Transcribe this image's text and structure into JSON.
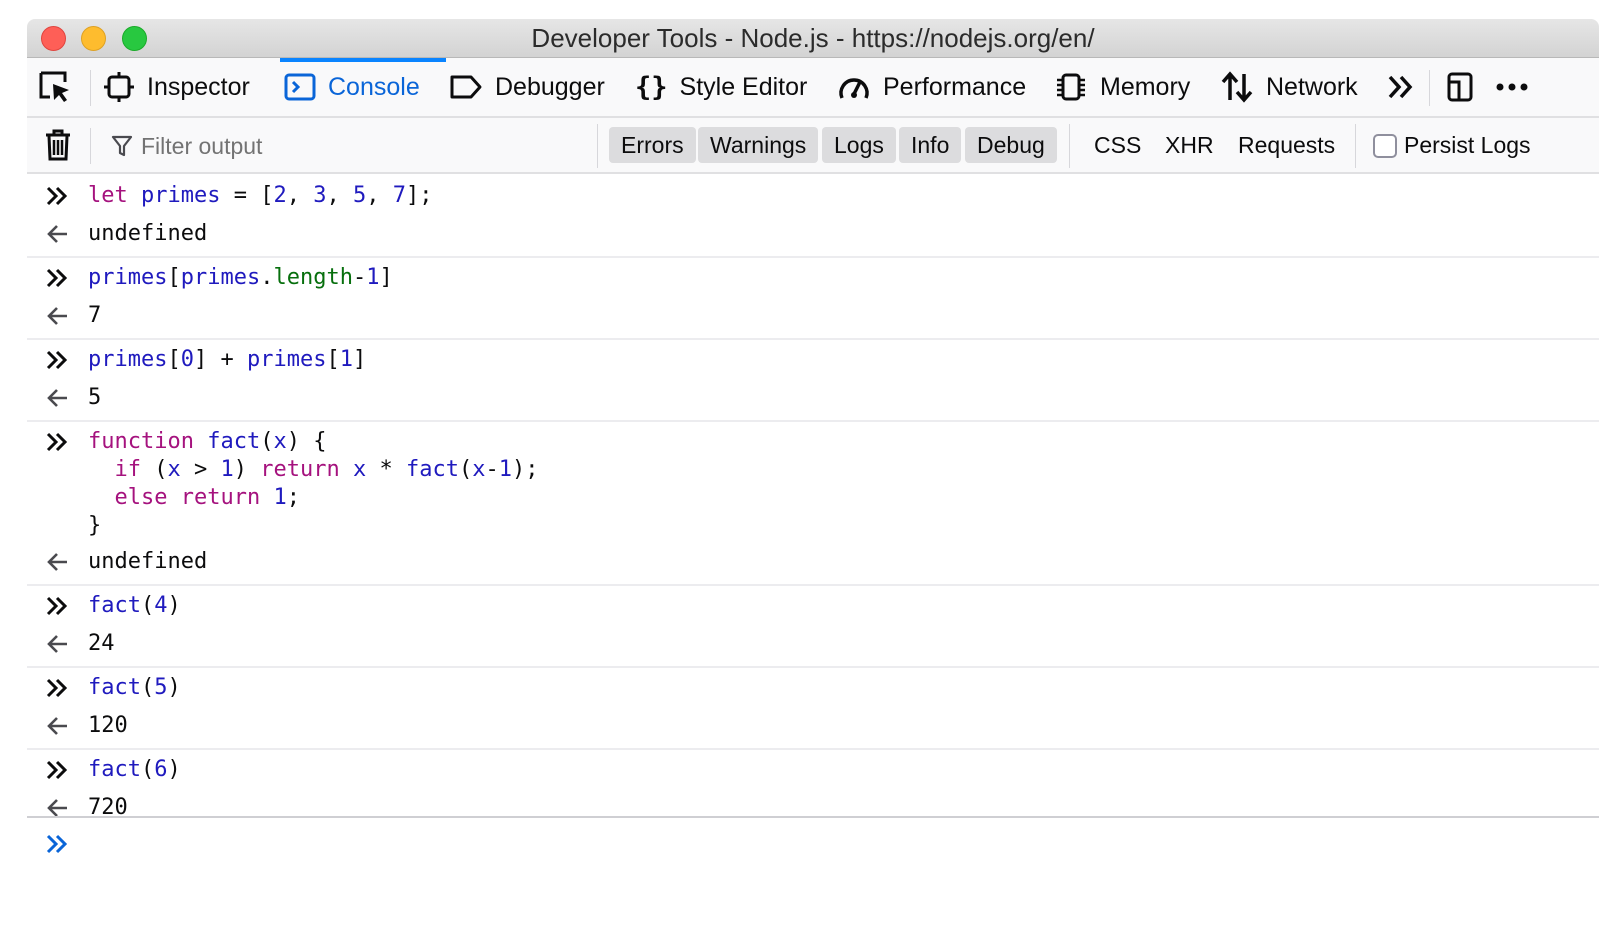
{
  "window": {
    "title": "Developer Tools - Node.js - https://nodejs.org/en/"
  },
  "toolbar": {
    "tabs": [
      {
        "label": "Inspector",
        "icon": "inspector-icon"
      },
      {
        "label": "Console",
        "icon": "console-icon",
        "selected": true
      },
      {
        "label": "Debugger",
        "icon": "debugger-icon"
      },
      {
        "label": "Style Editor",
        "icon": "style-editor-icon"
      },
      {
        "label": "Performance",
        "icon": "performance-icon"
      },
      {
        "label": "Memory",
        "icon": "memory-icon"
      },
      {
        "label": "Network",
        "icon": "network-icon"
      }
    ],
    "icons": [
      "element-picker-icon",
      "overflow-chevron-icon",
      "dock-icon",
      "more-options-icon"
    ]
  },
  "filterbar": {
    "placeholder": "Filter output",
    "chips": [
      "Errors",
      "Warnings",
      "Logs",
      "Info",
      "Debug"
    ],
    "buttons": [
      "CSS",
      "XHR",
      "Requests"
    ],
    "persist_label": "Persist Logs"
  },
  "console": {
    "entries": [
      {
        "input": "let primes = [2, 3, 5, 7];",
        "result": "undefined"
      },
      {
        "input": "primes[primes.length-1]",
        "result": "7"
      },
      {
        "input": "primes[0] + primes[1]",
        "result": "5"
      },
      {
        "input": "function fact(x) {\n  if (x > 1) return x * fact(x-1);\n  else return 1;\n}",
        "result": "undefined"
      },
      {
        "input": "fact(4)",
        "result": "24"
      },
      {
        "input": "fact(5)",
        "result": "120"
      },
      {
        "input": "fact(6)",
        "result": "720"
      }
    ]
  },
  "colors": {
    "keyword": "#a5127e",
    "identifier": "#1f1abe",
    "result": "#076f0d",
    "selected_tab": "#0a65d8"
  }
}
